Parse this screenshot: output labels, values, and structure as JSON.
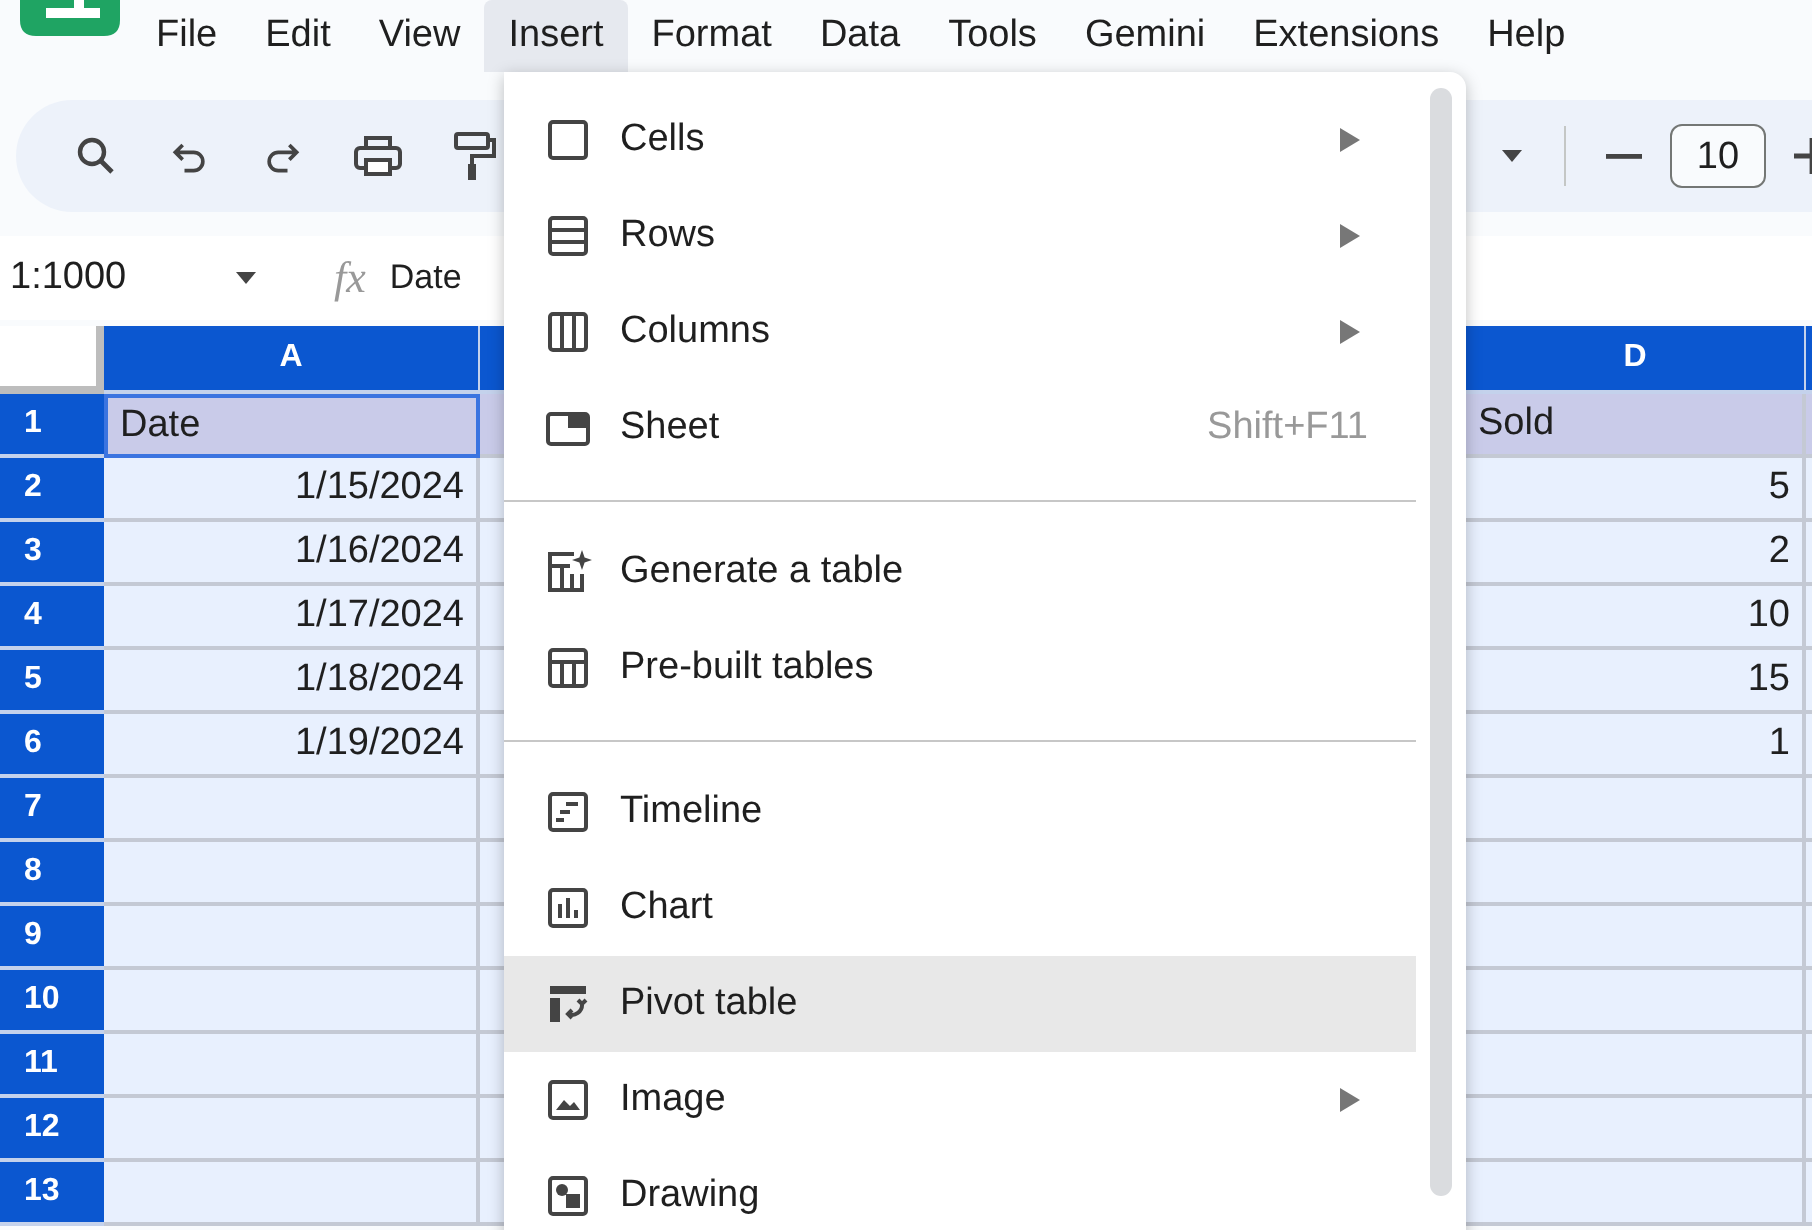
{
  "menubar": [
    {
      "label": "File",
      "selected": false
    },
    {
      "label": "Edit",
      "selected": false
    },
    {
      "label": "View",
      "selected": false
    },
    {
      "label": "Insert",
      "selected": true
    },
    {
      "label": "Format",
      "selected": false
    },
    {
      "label": "Data",
      "selected": false
    },
    {
      "label": "Tools",
      "selected": false
    },
    {
      "label": "Gemini",
      "selected": false
    },
    {
      "label": "Extensions",
      "selected": false
    },
    {
      "label": "Help",
      "selected": false
    }
  ],
  "toolbar": {
    "font_size": "10"
  },
  "formula_bar": {
    "name_box": "1:1000",
    "fx": "fx",
    "content": "Date"
  },
  "grid": {
    "columns": [
      "A",
      "D"
    ],
    "rows": [
      {
        "number": "1",
        "kind": "header",
        "cells": [
          {
            "text": "Date",
            "kind": "text",
            "selected": true
          },
          {
            "text": "Sold",
            "kind": "text",
            "selected": false
          }
        ]
      },
      {
        "number": "2",
        "kind": "data",
        "cells": [
          {
            "text": "1/15/2024",
            "kind": "number",
            "selected": false
          },
          {
            "text": "5",
            "kind": "number",
            "selected": false
          }
        ]
      },
      {
        "number": "3",
        "kind": "data",
        "cells": [
          {
            "text": "1/16/2024",
            "kind": "number",
            "selected": false
          },
          {
            "text": "2",
            "kind": "number",
            "selected": false
          }
        ]
      },
      {
        "number": "4",
        "kind": "data",
        "cells": [
          {
            "text": "1/17/2024",
            "kind": "number",
            "selected": false
          },
          {
            "text": "10",
            "kind": "number",
            "selected": false
          }
        ]
      },
      {
        "number": "5",
        "kind": "data",
        "cells": [
          {
            "text": "1/18/2024",
            "kind": "number",
            "selected": false
          },
          {
            "text": "15",
            "kind": "number",
            "selected": false
          }
        ]
      },
      {
        "number": "6",
        "kind": "data",
        "cells": [
          {
            "text": "1/19/2024",
            "kind": "number",
            "selected": false
          },
          {
            "text": "1",
            "kind": "number",
            "selected": false
          }
        ]
      },
      {
        "number": "7",
        "kind": "data",
        "cells": []
      },
      {
        "number": "8",
        "kind": "data",
        "cells": []
      },
      {
        "number": "9",
        "kind": "data",
        "cells": []
      },
      {
        "number": "10",
        "kind": "data",
        "cells": []
      },
      {
        "number": "11",
        "kind": "data",
        "cells": []
      },
      {
        "number": "12",
        "kind": "data",
        "cells": []
      },
      {
        "number": "13",
        "kind": "data",
        "cells": []
      }
    ]
  },
  "insert_menu": {
    "items": [
      {
        "kind": "item",
        "label": "Cells",
        "submenu": true,
        "hovered": false
      },
      {
        "kind": "item",
        "label": "Rows",
        "submenu": true,
        "hovered": false
      },
      {
        "kind": "item",
        "label": "Columns",
        "submenu": true,
        "hovered": false
      },
      {
        "kind": "item",
        "label": "Sheet",
        "shortcut": "Shift+F11",
        "submenu": false,
        "hovered": false
      },
      {
        "kind": "divider"
      },
      {
        "kind": "item",
        "label": "Generate a table",
        "submenu": false,
        "hovered": false
      },
      {
        "kind": "item",
        "label": "Pre-built tables",
        "submenu": false,
        "hovered": false
      },
      {
        "kind": "divider"
      },
      {
        "kind": "item",
        "label": "Timeline",
        "submenu": false,
        "hovered": false
      },
      {
        "kind": "item",
        "label": "Chart",
        "submenu": false,
        "hovered": false
      },
      {
        "kind": "item",
        "label": "Pivot table",
        "submenu": false,
        "hovered": true
      },
      {
        "kind": "item",
        "label": "Image",
        "submenu": true,
        "hovered": false
      },
      {
        "kind": "item",
        "label": "Drawing",
        "submenu": false,
        "hovered": false
      }
    ]
  }
}
